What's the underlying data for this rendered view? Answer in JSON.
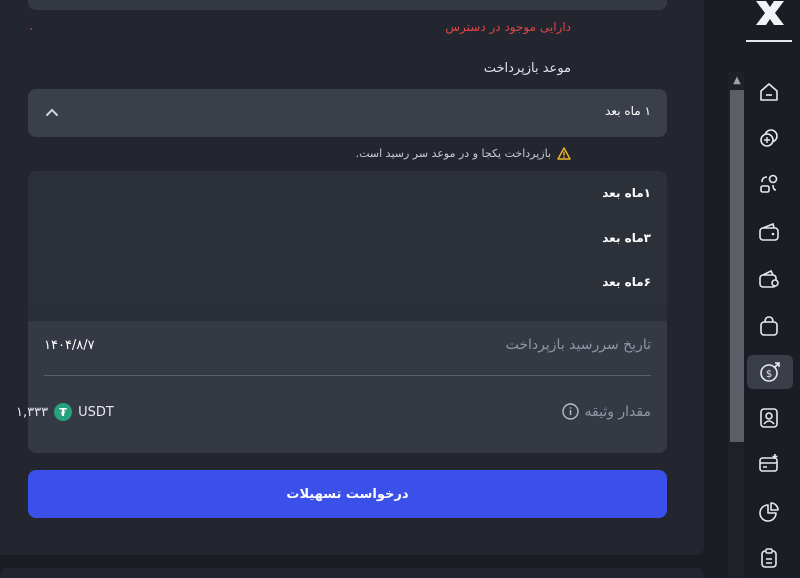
{
  "available_assets": {
    "label": "دارایی موجود در دسترس",
    "value": "۰"
  },
  "repayment": {
    "label": "موعد بازپرداخت",
    "selected": "۱ ماه بعد",
    "warning": "بازپرداخت یکجا و در موعد سر رسید است.",
    "options": [
      "۱ماه بعد",
      "۳ماه بعد",
      "۶ماه بعد"
    ]
  },
  "details": {
    "due_date_label": "تاریخ سررسید بازپرداخت",
    "due_date_value": "۱۴۰۴/۸/۷",
    "collateral_label": "مقدار وثیقه",
    "collateral_currency": "USDT",
    "collateral_value": "۱,۳۳۳"
  },
  "submit_label": "درخواست تسهیلات",
  "colors": {
    "accent": "#3b50e8",
    "error": "#e04646",
    "warning": "#f0b429",
    "tether": "#26a17b"
  },
  "sidebar_icons": [
    "home-icon",
    "coins-exchange-icon",
    "swap-icon",
    "wallet-icon",
    "wallet-card-icon",
    "bag-icon",
    "loan-dollar-icon",
    "user-id-icon",
    "card-plus-icon",
    "pie-chart-icon",
    "clipboard-icon"
  ]
}
